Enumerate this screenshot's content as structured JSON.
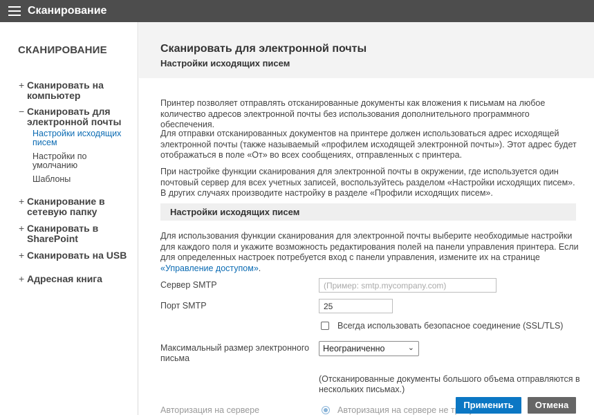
{
  "app": {
    "title": "Сканирование"
  },
  "sidebar": {
    "title": "СКАНИРОВАНИЕ",
    "items": [
      {
        "sign": "+",
        "label": "Сканировать на компьютер"
      },
      {
        "sign": "−",
        "label": "Сканировать для электронной почты"
      },
      {
        "sign": "+",
        "label": "Сканирование в сетевую папку"
      },
      {
        "sign": "+",
        "label": "Сканировать в SharePoint"
      },
      {
        "sign": "+",
        "label": "Сканировать на USB"
      },
      {
        "sign": "+",
        "label": "Адресная книга"
      }
    ],
    "subitems": [
      {
        "label": "Настройки исходящих писем",
        "active": true
      },
      {
        "label": "Настройки по умолчанию",
        "active": false
      },
      {
        "label": "Шаблоны",
        "active": false
      }
    ]
  },
  "main": {
    "title": "Сканировать для электронной почты",
    "subtitle": "Настройки исходящих писем",
    "paragraphs": [
      "Принтер позволяет отправлять отсканированные документы как вложения к письмам на любое количество адресов электронной почты без использования дополнительного программного обеспечения.",
      "Для отправки отсканированных документов на принтере должен использоваться адрес исходящей электронной почты (также называемый «профилем исходящей электронной почты»). Этот адрес будет отображаться в поле «От» во всех сообщениях, отправленных с принтера.",
      "При настройке функции сканирования для электронной почты в окружении, где используется один почтовый сервер для всех учетных записей, воспользуйтесь разделом «Настройки исходящих писем». В других случаях производите настройку в разделе «Профили исходящих писем»."
    ],
    "section": {
      "title": "Настройки исходящих писем",
      "intro": "Для использования функции сканирования для электронной почты выберите необходимые настройки для каждого поля и укажите возможность редактирования полей на панели управления принтера. Если для определенных настроек потребуется вход с панели управления, измените их на странице ",
      "intro_link": "«Управление доступом»",
      "intro_end": "."
    },
    "form": {
      "smtp_server_label": "Сервер SMTP",
      "smtp_server_value": "",
      "smtp_server_placeholder": "(Пример: smtp.mycompany.com)",
      "smtp_port_label": "Порт SMTP",
      "smtp_port_value": "25",
      "ssl_label": "Всегда использовать безопасное соединение (SSL/TLS)",
      "ssl_checked": false,
      "max_size_label": "Максимальный размер электронного письма",
      "max_size_value": "Неограниченно",
      "max_size_note": "(Отсканированные документы большого объема отправляются в нескольких письмах.)",
      "auth_label": "Авторизация на сервере",
      "auth_option": "Авторизация на сервере не требуется"
    }
  },
  "buttons": {
    "apply": "Применить",
    "cancel": "Отмена"
  },
  "colors": {
    "topbar": "#4d4d4d",
    "accent": "#0b77c4",
    "link": "#0b6bb3",
    "cancel": "#666666"
  }
}
